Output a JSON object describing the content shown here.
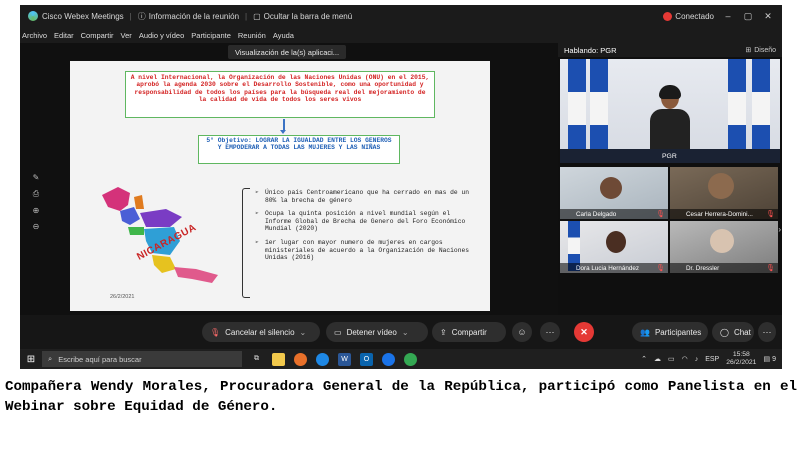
{
  "titlebar": {
    "app_name": "Cisco Webex Meetings",
    "meeting_info": "Información de la reunión",
    "hide_menu": "Ocultar la barra de menú",
    "status": "Conectado"
  },
  "menu": [
    "Archivo",
    "Editar",
    "Compartir",
    "Ver",
    "Audio y vídeo",
    "Participante",
    "Reunión",
    "Ayuda"
  ],
  "share": {
    "banner": "Visualización de la(s) aplicaci...",
    "slide": {
      "onu_text": "A nivel Internacional, la Organización de las Naciones Unidas (ONU) en el 2015, aprobó la agenda 2030 sobre el Desarrollo Sostenible, como una oportunidad y responsabilidad de todos los países para la búsqueda real del mejoramiento de la calidad de vida de todos los seres vivos",
      "objective_text": "5° Objetivo: LOGRAR LA IGUALDAD ENTRE LOS GENEROS Y EMPODERAR A TODAS LAS MUJERES Y LAS NIÑAS",
      "map_label": "NICARAGUA",
      "bullet_mark": "➢",
      "bullets": [
        "Único país Centroamericano que ha cerrado en mas de un 80% la brecha de género",
        "Ocupa la quinta posición a nivel mundial según el Informe Global de Brecha de Genero del Foro Económico Mundial (2020)",
        "1er lugar con mayor numero de mujeres en cargos ministeriales de acuerdo a la Organización de Naciones Unidas (2016)"
      ],
      "date": "26/2/2021"
    }
  },
  "video_panel": {
    "speaking": "Hablando: PGR",
    "layout_label": "Diseño",
    "main_name": "PGR",
    "participants": [
      "Carla Delgado",
      "Cesar Herrera-Domini...",
      "Dora Lucia Hernández",
      "Dr. Dressler"
    ]
  },
  "controls": {
    "mute": "Cancelar el silencio",
    "video": "Detener vídeo",
    "share": "Compartir",
    "participants": "Participantes",
    "chat": "Chat"
  },
  "taskbar": {
    "search_placeholder": "Escribe aquí para buscar",
    "lang": "ESP",
    "time": "15:58",
    "date": "26/2/2021",
    "notifications": "9"
  },
  "caption": "Compañera Wendy Morales, Procuradora General de la República, participó como Panelista en el Webinar sobre Equidad de Género.",
  "colors": {
    "onu_text": "#d32222",
    "objective_text": "#1f5fb5",
    "box_border": "#5fb760",
    "end_call": "#e53935"
  }
}
